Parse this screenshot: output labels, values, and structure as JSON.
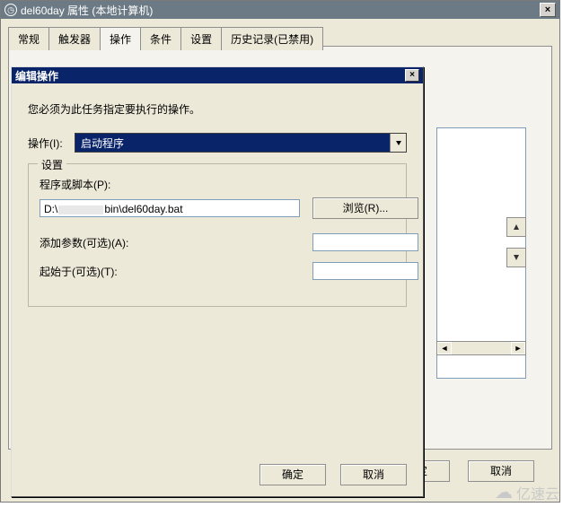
{
  "parentWindow": {
    "title": "del60day 属性 (本地计算机)",
    "tabs": [
      "常规",
      "触发器",
      "操作",
      "条件",
      "设置",
      "历史记录(已禁用)"
    ],
    "activeTabIndex": 2,
    "buttons": {
      "ok": "确定",
      "cancel": "取消"
    }
  },
  "dialog": {
    "title": "编辑操作",
    "instruction": "您必须为此任务指定要执行的操作。",
    "actionLabel": "操作(I):",
    "actionValue": "启动程序",
    "group": {
      "legend": "设置",
      "programLabel": "程序或脚本(P):",
      "programPrefix": "D:\\",
      "programSuffix": "bin\\del60day.bat",
      "browse": "浏览(R)...",
      "argsLabel": "添加参数(可选)(A):",
      "argsValue": "",
      "startInLabel": "起始于(可选)(T):",
      "startInValue": ""
    },
    "buttons": {
      "ok": "确定",
      "cancel": "取消"
    }
  },
  "watermark": "亿速云"
}
